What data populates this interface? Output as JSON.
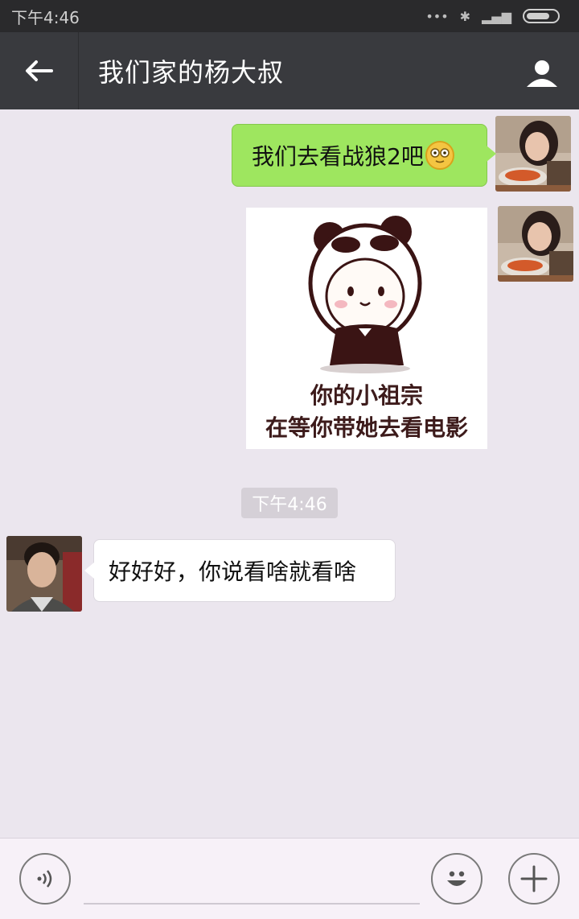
{
  "status_bar": {
    "time": "下午4:46"
  },
  "header": {
    "title": "我们家的杨大叔"
  },
  "messages": {
    "msg1": {
      "text": "我们去看战狼2吧",
      "side": "right",
      "emoji": "smiling-face-icon"
    },
    "sticker": {
      "line1": "你的小祖宗",
      "line2": "在等你带她去看电影"
    },
    "timestamp": "下午4:46",
    "msg3": {
      "text": "好好好，你说看啥就看啥",
      "side": "left"
    }
  },
  "input_bar": {
    "value": "",
    "placeholder": ""
  },
  "colors": {
    "status_bar": "#2a2a2c",
    "title_bar": "#393a3e",
    "chat_background": "#ebe6ee",
    "sent_bubble": "#9ee65f",
    "received_bubble": "#ffffff"
  }
}
